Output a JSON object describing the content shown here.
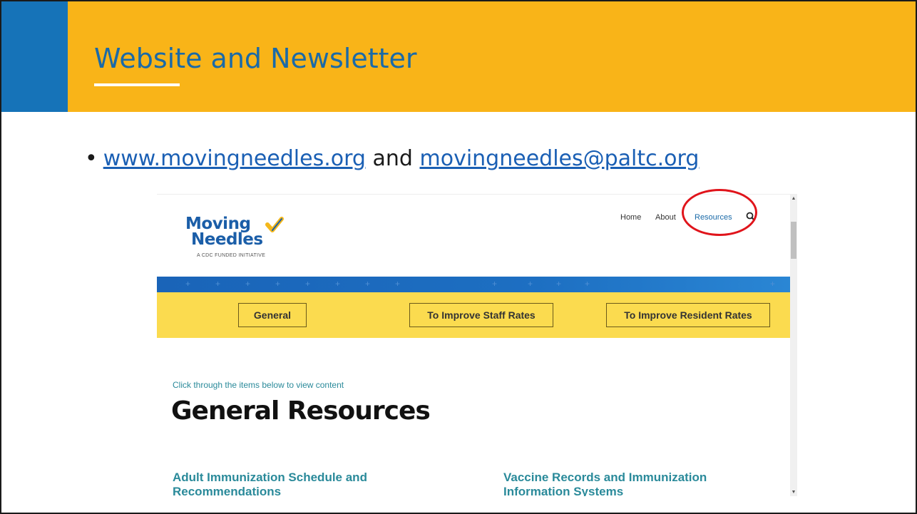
{
  "slide": {
    "title": "Website and Newsletter",
    "bullet": {
      "website_link": "www.movingneedles.org",
      "connector": "and",
      "email_link": "movingneedles@paltc.org"
    }
  },
  "website": {
    "logo": {
      "line1": "Moving",
      "line2": "Needles",
      "tagline": "A CDC FUNDED INITIATIVE"
    },
    "nav": {
      "items": [
        "Home",
        "About",
        "Resources"
      ],
      "active": "Resources"
    },
    "tabs": [
      "General",
      "To Improve Staff Rates",
      "To Improve Resident Rates"
    ],
    "intro_text": "Click through the items below to view content",
    "heading": "General Resources",
    "resources": [
      "Adult Immunization Schedule and Recommendations",
      "Vaccine Records and Immunization Information Systems"
    ]
  },
  "colors": {
    "banner": "#f9b418",
    "banner_accent": "#1673b8",
    "title": "#1a6aa8",
    "link": "#1a5fb4",
    "site_blue_band": "#1d6fc2",
    "site_yellow_band": "#fbdb4f",
    "site_teal": "#2a8a9a",
    "highlight_circle": "#e0141b"
  },
  "icons": {
    "search": "search-icon",
    "logo_mark": "check-mark-icon"
  }
}
